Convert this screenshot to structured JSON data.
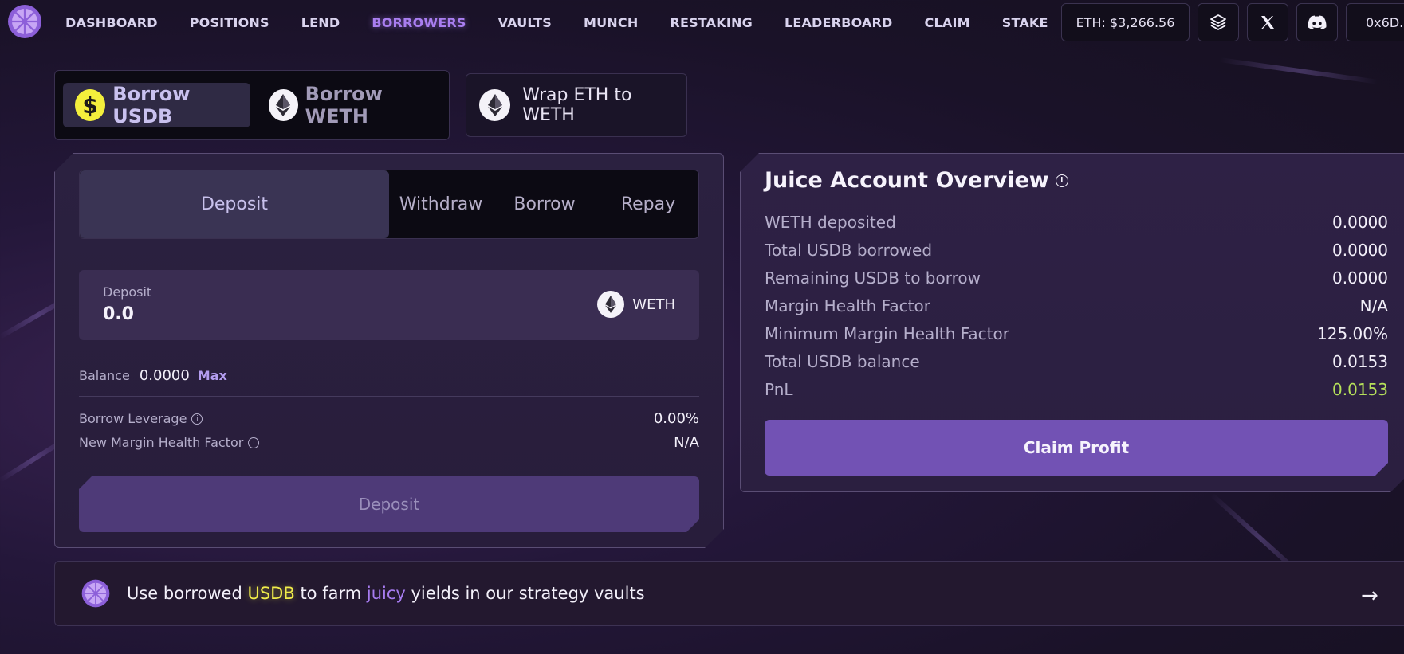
{
  "nav": {
    "links": [
      "DASHBOARD",
      "POSITIONS",
      "LEND",
      "BORROWERS",
      "VAULTS",
      "MUNCH",
      "RESTAKING",
      "LEADERBOARD",
      "CLAIM",
      "STAKE"
    ],
    "active": "BORROWERS",
    "eth_price": "ETH: $3,266.56",
    "wallet_address": "0x6D..."
  },
  "borrow_switch": {
    "usdb_label": "Borrow USDB",
    "weth_label": "Borrow WETH",
    "active": "Borrow USDB"
  },
  "wrap_button": {
    "label": "Wrap ETH to WETH"
  },
  "action_panel": {
    "tabs": [
      "Deposit",
      "Withdraw",
      "Borrow",
      "Repay"
    ],
    "active_tab": "Deposit",
    "deposit_label": "Deposit",
    "deposit_value": "0.0",
    "token": "WETH",
    "balance_label": "Balance",
    "balance_value": "0.0000",
    "max_label": "Max",
    "borrow_leverage_label": "Borrow Leverage",
    "borrow_leverage_value": "0.00%",
    "new_mhf_label": "New Margin Health Factor",
    "new_mhf_value": "N/A",
    "submit_label": "Deposit"
  },
  "overview": {
    "title": "Juice Account Overview",
    "rows": [
      {
        "label": "WETH deposited",
        "value": "0.0000"
      },
      {
        "label": "Total USDB borrowed",
        "value": "0.0000"
      },
      {
        "label": "Remaining USDB to borrow",
        "value": "0.0000"
      },
      {
        "label": "Margin Health Factor",
        "value": "N/A"
      },
      {
        "label": "Minimum Margin Health Factor",
        "value": "125.00%"
      },
      {
        "label": "Total USDB balance",
        "value": "0.0153"
      },
      {
        "label": "PnL",
        "value": "0.0153"
      }
    ],
    "claim_label": "Claim Profit",
    "pnl_color": "#b6e05a"
  },
  "banner": {
    "text_1": "Use borrowed ",
    "highlight_usdb": "USDB",
    "text_2": " to farm ",
    "highlight_juicy": "juicy",
    "text_3": " yields in our strategy vaults"
  },
  "colors": {
    "accent": "#a97ef0",
    "usdb_yellow": "#f3ef3c",
    "button_purple": "#7252b4"
  }
}
